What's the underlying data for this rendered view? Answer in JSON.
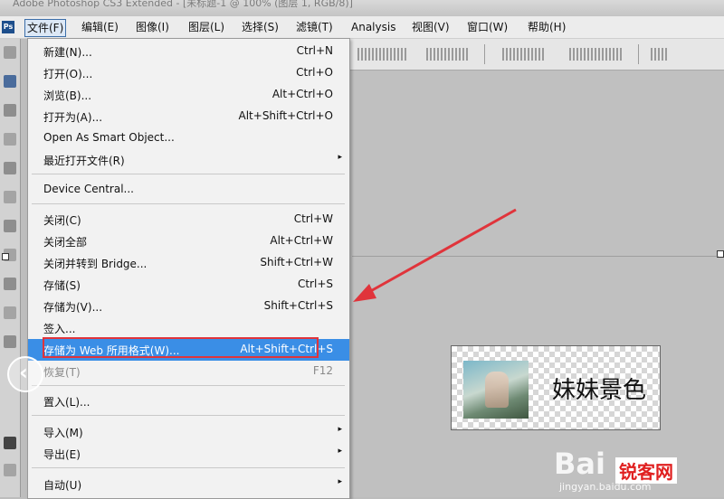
{
  "titlebar": {
    "text": "Adobe Photoshop CS3 Extended - [未标题-1 @ 100% (图层 1, RGB/8)]"
  },
  "menubar": {
    "logo": "Ps",
    "items": [
      "文件(F)",
      "编辑(E)",
      "图像(I)",
      "图层(L)",
      "选择(S)",
      "滤镜(T)",
      "Analysis",
      "视图(V)",
      "窗口(W)",
      "帮助(H)"
    ]
  },
  "file_menu": {
    "items": [
      {
        "label": "新建(N)...",
        "shortcut": "Ctrl+N"
      },
      {
        "label": "打开(O)...",
        "shortcut": "Ctrl+O"
      },
      {
        "label": "浏览(B)...",
        "shortcut": "Alt+Ctrl+O"
      },
      {
        "label": "打开为(A)...",
        "shortcut": "Alt+Shift+Ctrl+O"
      },
      {
        "label": "Open As Smart Object...",
        "shortcut": ""
      },
      {
        "label": "最近打开文件(R)",
        "shortcut": "",
        "submenu": true
      },
      {
        "label": "Device Central...",
        "shortcut": ""
      },
      {
        "label": "关闭(C)",
        "shortcut": "Ctrl+W"
      },
      {
        "label": "关闭全部",
        "shortcut": "Alt+Ctrl+W"
      },
      {
        "label": "关闭并转到 Bridge...",
        "shortcut": "Shift+Ctrl+W"
      },
      {
        "label": "存储(S)",
        "shortcut": "Ctrl+S"
      },
      {
        "label": "存储为(V)...",
        "shortcut": "Shift+Ctrl+S"
      },
      {
        "label": "签入...",
        "shortcut": ""
      },
      {
        "label": "存储为 Web 所用格式(W)...",
        "shortcut": "Alt+Shift+Ctrl+S",
        "highlighted": true
      },
      {
        "label": "恢复(T)",
        "shortcut": "F12",
        "disabled": true
      },
      {
        "label": "置入(L)...",
        "shortcut": ""
      },
      {
        "label": "导入(M)",
        "shortcut": "",
        "submenu": true
      },
      {
        "label": "导出(E)",
        "shortcut": "",
        "submenu": true
      },
      {
        "label": "自动(U)",
        "shortcut": "",
        "submenu": true
      }
    ]
  },
  "canvas": {
    "image_caption": "妹妹景色"
  },
  "watermark": {
    "brand": "Bai",
    "site_badge": "锐客网",
    "url": "jingyan.baidu.com"
  },
  "colors": {
    "highlight": "#3a8ee6",
    "annotation_red": "#e0343b"
  },
  "icons": {
    "submenu_arrow": "▸",
    "back_button": "‹"
  }
}
